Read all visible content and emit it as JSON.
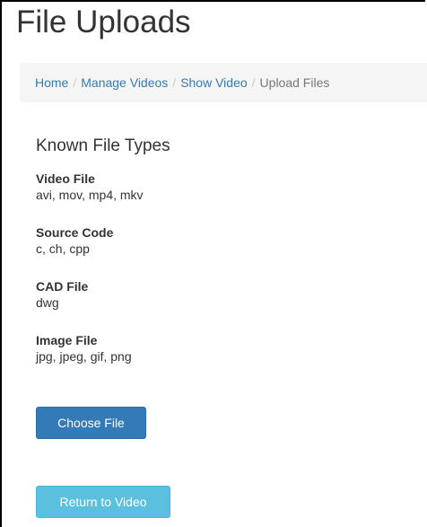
{
  "page": {
    "title": "File Uploads"
  },
  "breadcrumb": {
    "items": [
      {
        "label": "Home",
        "active": false
      },
      {
        "label": "Manage Videos",
        "active": false
      },
      {
        "label": "Show Video",
        "active": false
      },
      {
        "label": "Upload Files",
        "active": true
      }
    ],
    "separator": "/"
  },
  "known_types": {
    "heading": "Known File Types",
    "items": [
      {
        "name": "Video File",
        "extensions": "avi, mov, mp4, mkv"
      },
      {
        "name": "Source Code",
        "extensions": "c, ch, cpp"
      },
      {
        "name": "CAD File",
        "extensions": "dwg"
      },
      {
        "name": "Image File",
        "extensions": "jpg, jpeg, gif, png"
      }
    ]
  },
  "buttons": {
    "choose_file": "Choose File",
    "return_to_video": "Return to Video"
  },
  "colors": {
    "link": "#337ab7",
    "primary_button": "#337ab7",
    "info_button": "#5bc0de",
    "breadcrumb_bg": "#f5f5f5",
    "active_crumb": "#777777"
  }
}
